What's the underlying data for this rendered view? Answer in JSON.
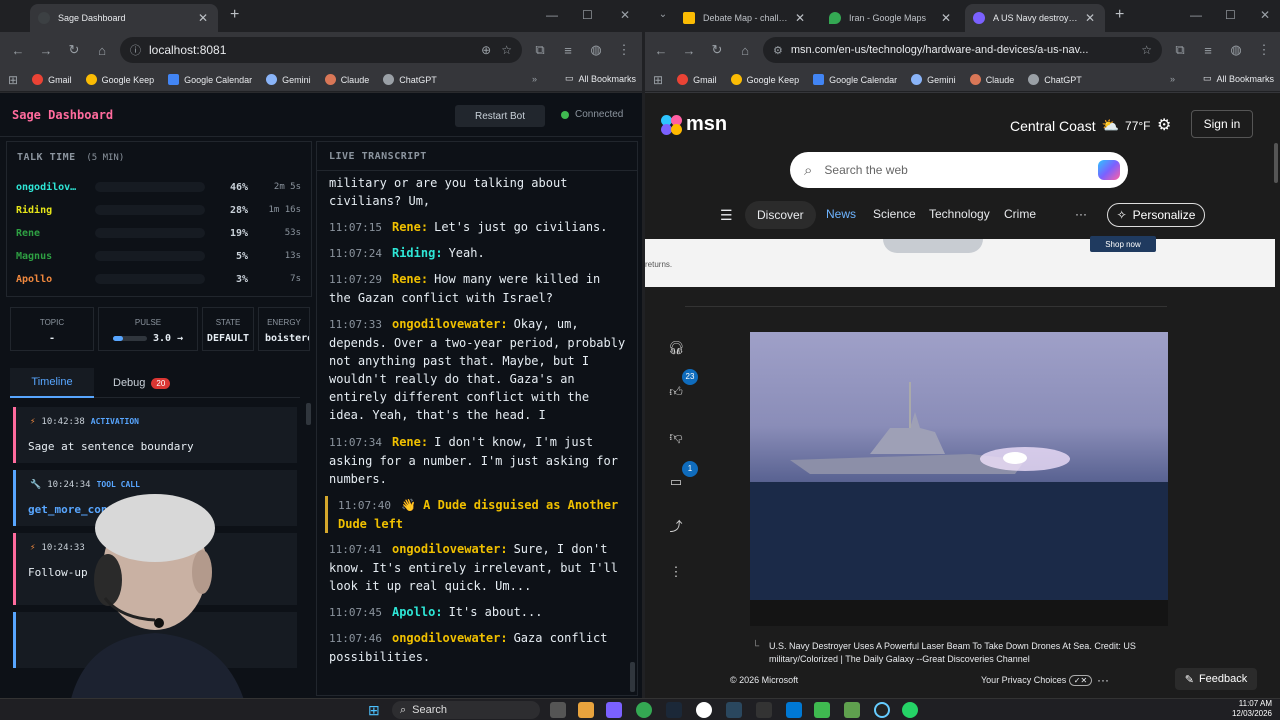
{
  "left_window": {
    "tab_title": "Sage Dashboard",
    "url": "localhost:8081",
    "bookmarks": [
      "Gmail",
      "Google Keep",
      "Google Calendar",
      "Gemini",
      "Claude",
      "ChatGPT"
    ],
    "all_bookmarks": "All Bookmarks"
  },
  "right_window": {
    "tabs": [
      "Debate Map - challenge",
      "Iran - Google Maps",
      "A US Navy destroyer vap"
    ],
    "url": "msn.com/en-us/technology/hardware-and-devices/a-us-nav...",
    "bookmarks": [
      "Gmail",
      "Google Keep",
      "Google Calendar",
      "Gemini",
      "Claude",
      "ChatGPT"
    ],
    "all_bookmarks": "All Bookmarks"
  },
  "sage": {
    "title": "Sage Dashboard",
    "restart_label": "Restart Bot",
    "status": "Connected",
    "talk_time": {
      "heading": "TALK TIME",
      "window": "(5 MIN)",
      "rows": [
        {
          "name": "ongodilov…",
          "pct": "46%",
          "dur": "2m 5s",
          "fraction": 0.46,
          "color": "#2ee6d6"
        },
        {
          "name": "Riding",
          "pct": "28%",
          "dur": "1m 16s",
          "fraction": 0.28,
          "color": "#e6e619"
        },
        {
          "name": "Rene",
          "pct": "19%",
          "dur": "53s",
          "fraction": 0.19,
          "color": "#2ea043"
        },
        {
          "name": "Magnus",
          "pct": "5%",
          "dur": "13s",
          "fraction": 0.05,
          "color": "#2ea043"
        },
        {
          "name": "Apollo",
          "pct": "3%",
          "dur": "7s",
          "fraction": 0.03,
          "color": "#f0883e"
        }
      ]
    },
    "stats": {
      "topic_label": "TOPIC",
      "topic_value": "-",
      "pulse_label": "PULSE",
      "pulse_value": "3.0 →",
      "state_label": "STATE",
      "state_value": "DEFAULT",
      "energy_label": "ENERGY",
      "energy_value": "boistero"
    },
    "tabs": {
      "timeline": "Timeline",
      "debug": "Debug",
      "debug_count": "20"
    },
    "timeline": [
      {
        "time": "10:42:38",
        "kind": "ACTIVATION",
        "text": "Sage at sentence boundary"
      },
      {
        "time": "10:24:34",
        "kind": "TOOL CALL",
        "text": "get_more_cont"
      },
      {
        "time": "10:24:33",
        "kind": "",
        "text": "Follow-up … sage will judge"
      }
    ],
    "transcript_heading": "LIVE TRANSCRIPT",
    "transcript": [
      {
        "time": "",
        "speaker": "",
        "text": "military or are you talking about civilians? Um,"
      },
      {
        "time": "11:07:15",
        "speaker": "Rene:",
        "text": "Let's just go civilians."
      },
      {
        "time": "11:07:24",
        "speaker": "Riding:",
        "text": "Yeah."
      },
      {
        "time": "11:07:29",
        "speaker": "Rene:",
        "text": "How many were killed in the Gazan conflict with Israel?"
      },
      {
        "time": "11:07:33",
        "speaker": "ongodilovewater:",
        "text": "Okay, um, depends. Over a two-year period, probably not anything past that. Maybe, but I wouldn't really do that. Gaza's an entirely different conflict with the idea. Yeah, that's the head. I"
      },
      {
        "time": "11:07:34",
        "speaker": "Rene:",
        "text": "I don't know, I'm just asking for a number. I'm just asking for numbers."
      },
      {
        "time": "11:07:40",
        "speaker": "",
        "text": "👋 A Dude disguised as Another Dude left"
      },
      {
        "time": "11:07:41",
        "speaker": "ongodilovewater:",
        "text": "Sure, I don't know. It's entirely irrelevant, but I'll look it up real quick. Um..."
      },
      {
        "time": "11:07:45",
        "speaker": "Apollo:",
        "text": "It's about..."
      },
      {
        "time": "11:07:46",
        "speaker": "ongodilovewater:",
        "text": "Gaza conflict possibilities."
      }
    ]
  },
  "msn": {
    "logo": "msn",
    "location": "Central Coast",
    "temp": "77°F",
    "signin": "Sign in",
    "search_placeholder": "Search the web",
    "nav": [
      "Discover",
      "News",
      "Science",
      "Technology",
      "Crime"
    ],
    "more": "···",
    "personalize": "Personalize",
    "banner_text": "returns.",
    "banner_button": "Shop now",
    "like_count": "23",
    "comment_count": "1",
    "caption": "U.S. Navy Destroyer Uses A Powerful Laser Beam To Take Down Drones At Sea. Credit: US military/Colorized | The Daily Galaxy --Great Discoveries Channel",
    "copyright": "© 2026 Microsoft",
    "privacy": "Your Privacy Choices",
    "feedback": "Feedback"
  },
  "taskbar": {
    "search": "Search",
    "time": "11:07 AM",
    "date": "12/03/2026"
  }
}
